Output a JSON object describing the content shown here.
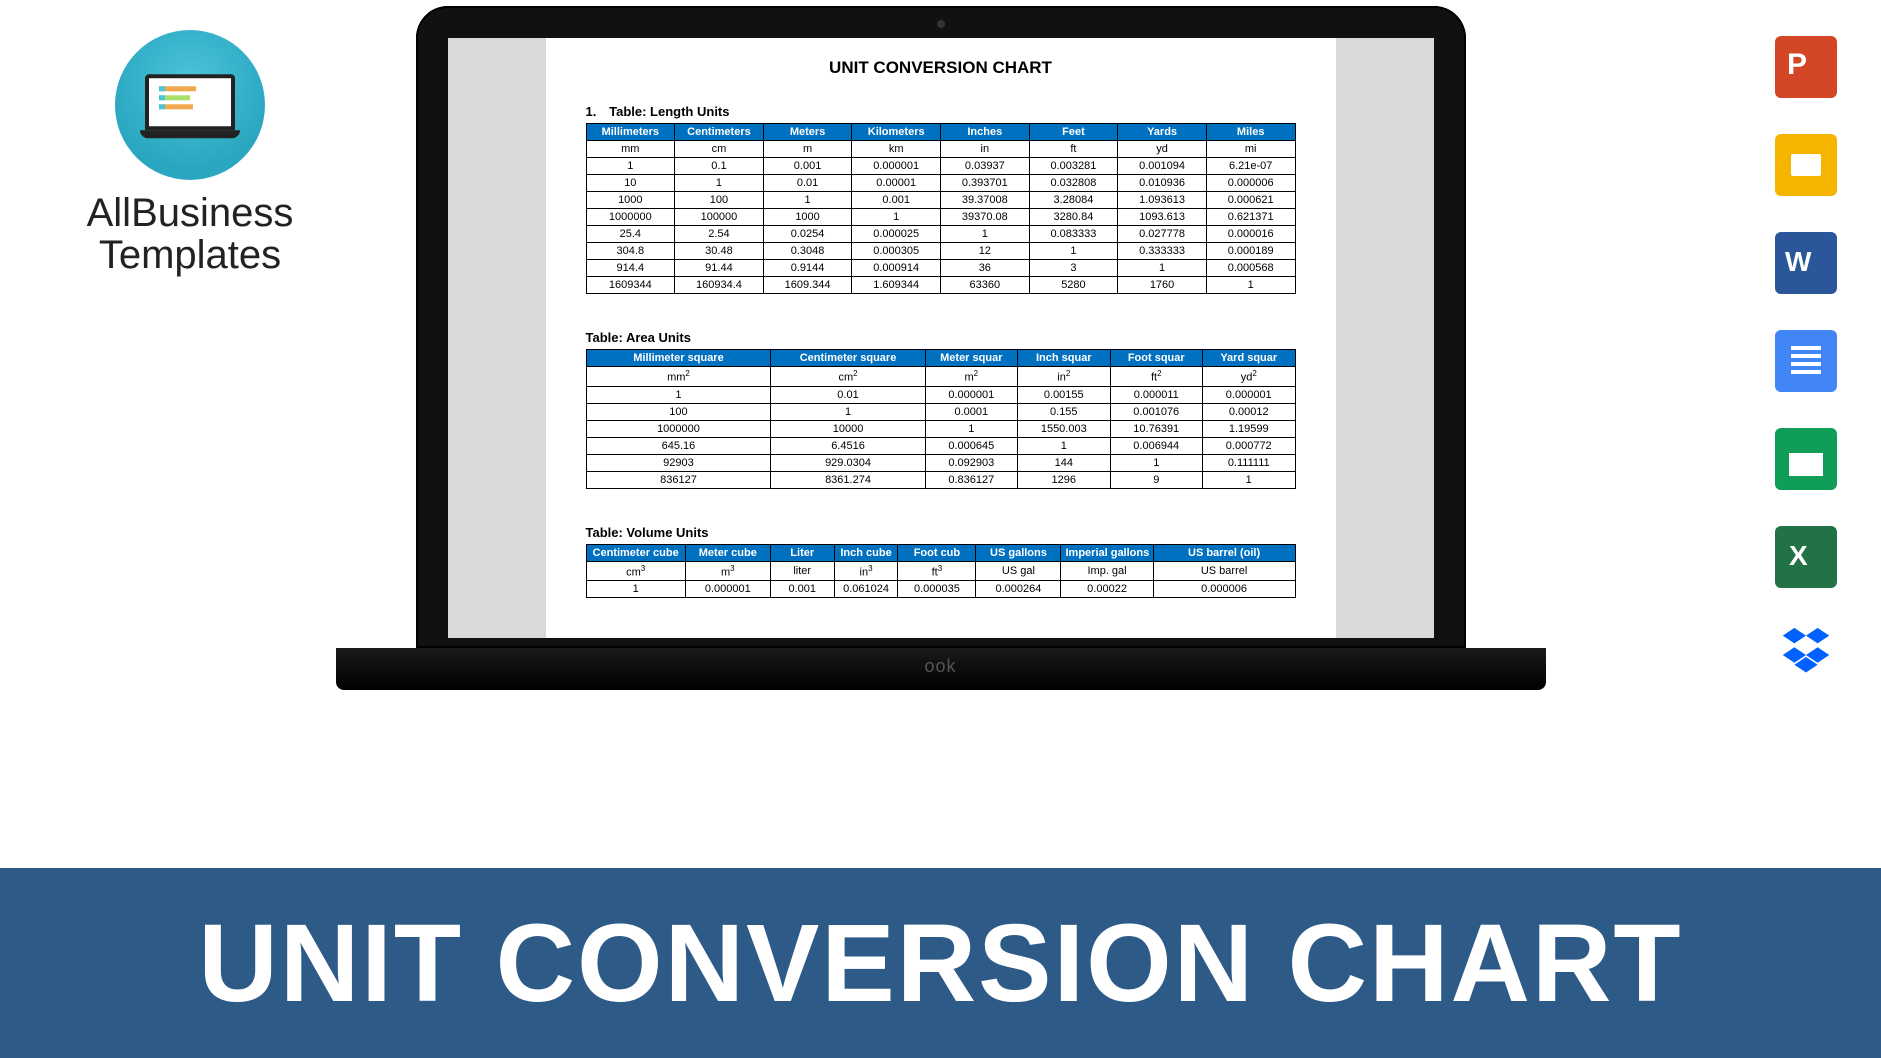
{
  "brand": {
    "line1": "AllBusiness",
    "line2": "Templates"
  },
  "banner": "UNIT CONVERSION CHART",
  "laptop_label": "ook",
  "doc": {
    "title": "UNIT CONVERSION CHART",
    "section1_number": "1.",
    "section1_label": "Table:  Length Units",
    "section2_label": "Table:  Area Units",
    "section3_label": "Table:  Volume Units"
  },
  "icons": {
    "ppt": "PowerPoint",
    "slides": "Google Slides",
    "word": "Word",
    "docs": "Google Docs",
    "sheets": "Google Sheets",
    "excel": "Excel",
    "dropbox": "Dropbox"
  },
  "chart_data": [
    {
      "type": "table",
      "title": "Length Units",
      "headers": [
        "Millimeters",
        "Centimeters",
        "Meters",
        "Kilometers",
        "Inches",
        "Feet",
        "Yards",
        "Miles"
      ],
      "unit_row": [
        "mm",
        "cm",
        "m",
        "km",
        "in",
        "ft",
        "yd",
        "mi"
      ],
      "rows": [
        [
          "1",
          "0.1",
          "0.001",
          "0.000001",
          "0.03937",
          "0.003281",
          "0.001094",
          "6.21e-07"
        ],
        [
          "10",
          "1",
          "0.01",
          "0.00001",
          "0.393701",
          "0.032808",
          "0.010936",
          "0.000006"
        ],
        [
          "1000",
          "100",
          "1",
          "0.001",
          "39.37008",
          "3.28084",
          "1.093613",
          "0.000621"
        ],
        [
          "1000000",
          "100000",
          "1000",
          "1",
          "39370.08",
          "3280.84",
          "1093.613",
          "0.621371"
        ],
        [
          "25.4",
          "2.54",
          "0.0254",
          "0.000025",
          "1",
          "0.083333",
          "0.027778",
          "0.000016"
        ],
        [
          "304.8",
          "30.48",
          "0.3048",
          "0.000305",
          "12",
          "1",
          "0.333333",
          "0.000189"
        ],
        [
          "914.4",
          "91.44",
          "0.9144",
          "0.000914",
          "36",
          "3",
          "1",
          "0.000568"
        ],
        [
          "1609344",
          "160934.4",
          "1609.344",
          "1.609344",
          "63360",
          "5280",
          "1760",
          "1"
        ]
      ]
    },
    {
      "type": "table",
      "title": "Area Units",
      "headers": [
        "Millimeter square",
        "Centimeter square",
        "Meter squar",
        "Inch squar",
        "Foot squar",
        "Yard squar"
      ],
      "unit_row": [
        "mm²",
        "cm²",
        "m²",
        "in²",
        "ft²",
        "yd²"
      ],
      "rows": [
        [
          "1",
          "0.01",
          "0.000001",
          "0.00155",
          "0.000011",
          "0.000001"
        ],
        [
          "100",
          "1",
          "0.0001",
          "0.155",
          "0.001076",
          "0.00012"
        ],
        [
          "1000000",
          "10000",
          "1",
          "1550.003",
          "10.76391",
          "1.19599"
        ],
        [
          "645.16",
          "6.4516",
          "0.000645",
          "1",
          "0.006944",
          "0.000772"
        ],
        [
          "92903",
          "929.0304",
          "0.092903",
          "144",
          "1",
          "0.111111"
        ],
        [
          "836127",
          "8361.274",
          "0.836127",
          "1296",
          "9",
          "1"
        ]
      ]
    },
    {
      "type": "table",
      "title": "Volume Units",
      "headers": [
        "Centimeter cube",
        "Meter cube",
        "Liter",
        "Inch cube",
        "Foot cub",
        "US gallons",
        "Imperial gallons",
        "US barrel (oil)"
      ],
      "unit_row": [
        "cm³",
        "m³",
        "liter",
        "in³",
        "ft³",
        "US gal",
        "Imp. gal",
        "US barrel"
      ],
      "rows": [
        [
          "1",
          "0.000001",
          "0.001",
          "0.061024",
          "0.000035",
          "0.000264",
          "0.00022",
          "0.000006"
        ]
      ]
    }
  ]
}
